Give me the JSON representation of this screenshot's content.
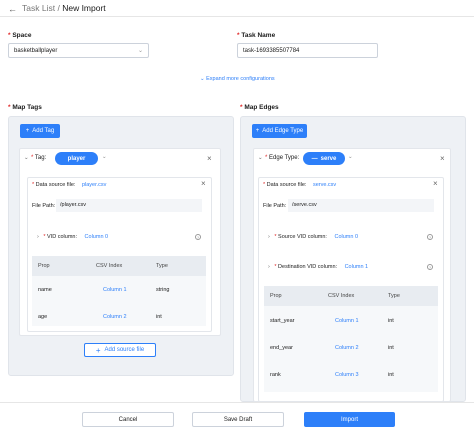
{
  "header": {
    "back_icon": "arrow-left-icon",
    "crumb_list": "Task List",
    "separator": "/",
    "crumb_current": "New Import"
  },
  "form": {
    "space_label": "Space",
    "space_value": "basketballplayer",
    "task_label": "Task Name",
    "task_value": "task-1693385507784",
    "expand_label": "Expand more configurations"
  },
  "map_tags": {
    "title": "Map Tags",
    "add_btn": "Add Tag",
    "tag_label": "Tag:",
    "tag_value": "player",
    "source_label": "Data source file:",
    "source_file": "player.csv",
    "path_label": "File Path:",
    "path_value": "/player.csv",
    "vid_label": "VID column:",
    "vid_value": "Column 0",
    "cols": [
      "Prop",
      "CSV Index",
      "Type"
    ],
    "rows": [
      {
        "prop": "name",
        "index": "Column 1",
        "type": "string"
      },
      {
        "prop": "age",
        "index": "Column 2",
        "type": "int"
      }
    ],
    "add_source_btn": "Add source file"
  },
  "map_edges": {
    "title": "Map Edges",
    "add_btn": "Add Edge Type",
    "edge_label": "Edge Type:",
    "edge_value": "serve",
    "source_label": "Data source file:",
    "source_file": "serve.csv",
    "path_label": "File Path:",
    "path_value": "/serve.csv",
    "src_vid_label": "Source VID column:",
    "src_vid_value": "Column 0",
    "dst_vid_label": "Destination VID column:",
    "dst_vid_value": "Column 1",
    "cols": [
      "Prop",
      "CSV Index",
      "Type"
    ],
    "rows": [
      {
        "prop": "start_year",
        "index": "Column 1",
        "type": "int"
      },
      {
        "prop": "end_year",
        "index": "Column 2",
        "type": "int"
      },
      {
        "prop": "rank",
        "index": "Column 3",
        "type": "int"
      }
    ]
  },
  "footer": {
    "cancel": "Cancel",
    "save_draft": "Save Draft",
    "import": "Import"
  },
  "colors": {
    "accent": "#2d7ff9",
    "required": "#e02424"
  }
}
